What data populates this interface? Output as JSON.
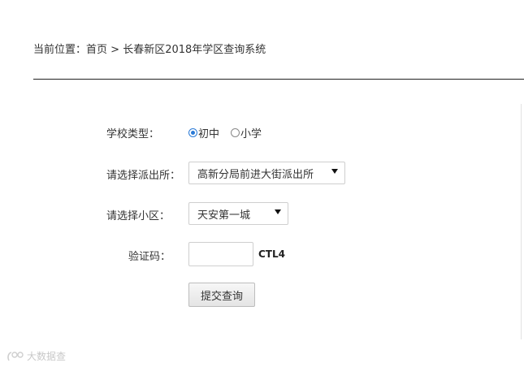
{
  "breadcrumb": {
    "prefix": "当前位置：",
    "home": "首页",
    "separator": " > ",
    "current": "长春新区2018年学区查询系统"
  },
  "form": {
    "school_type_label": "学校类型：",
    "school_type_options": [
      {
        "label": "初中",
        "checked": true
      },
      {
        "label": "小学",
        "checked": false
      }
    ],
    "police_label": "请选择派出所：",
    "police_selected": "高新分局前进大街派出所",
    "community_label": "请选择小区：",
    "community_selected": "天安第一城",
    "captcha_label": "验证码：",
    "captcha_input_value": "",
    "captcha_code": "CTL4",
    "submit_label": "提交查询"
  },
  "watermark": {
    "text": "大数据查"
  },
  "colors": {
    "radio_accent": "#2a7ad6",
    "divider": "#222222"
  }
}
